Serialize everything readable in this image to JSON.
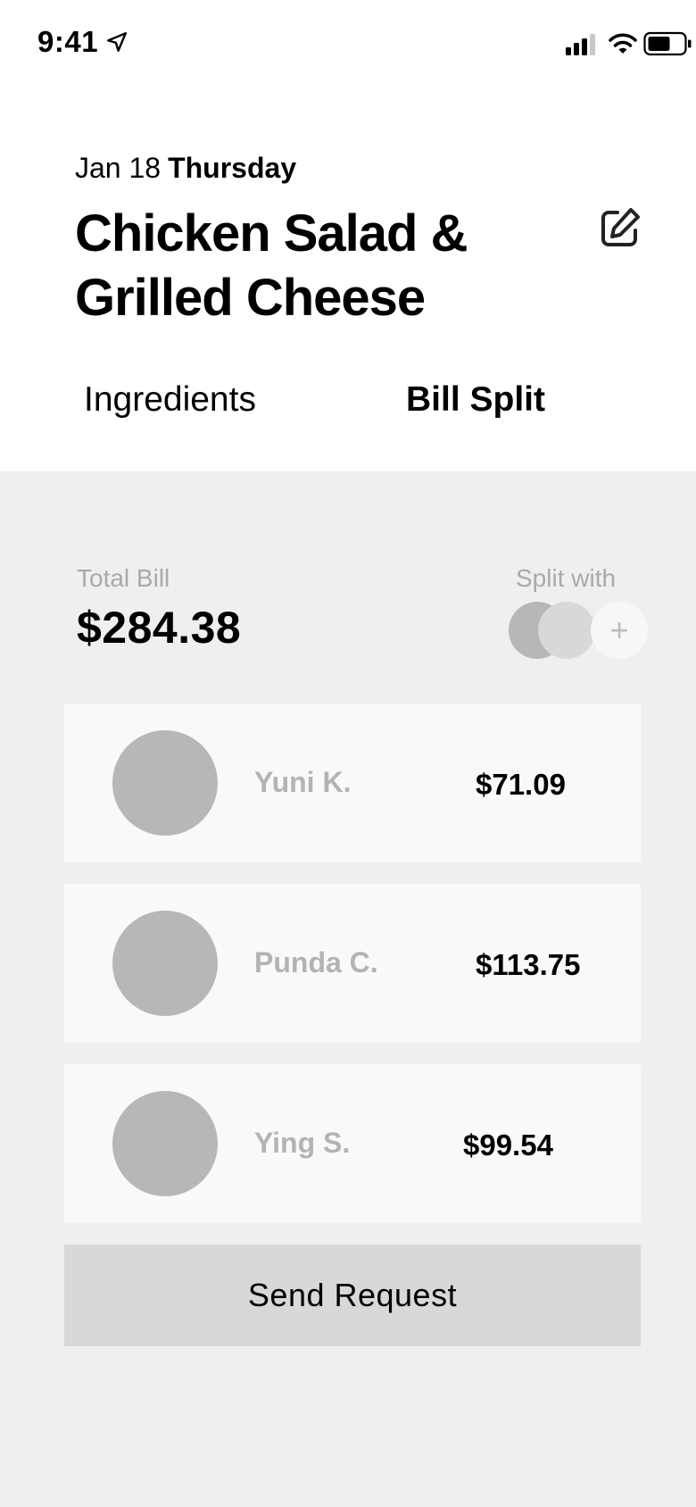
{
  "status_bar": {
    "time": "9:41"
  },
  "header": {
    "date": "Jan 18",
    "weekday": "Thursday",
    "title": "Chicken Salad & Grilled Cheese"
  },
  "tabs": [
    {
      "label": "Ingredients",
      "selected": false
    },
    {
      "label": "Bill Split",
      "selected": true
    }
  ],
  "bill": {
    "total_label": "Total Bill",
    "total_amount": "$284.38",
    "split_label": "Split with",
    "add_symbol": "+"
  },
  "people": [
    {
      "name": "Yuni K.",
      "amount": "$71.09"
    },
    {
      "name": "Punda C.",
      "amount": "$113.75"
    },
    {
      "name": "Ying S.",
      "amount": "$99.54"
    }
  ],
  "actions": {
    "send_label": "Send Request"
  },
  "colors": {
    "background": "#efefef",
    "card": "#f9f9f9",
    "avatar": "#b7b7b7",
    "button": "#d8d8d8",
    "muted_text": "#a9a9a9"
  }
}
